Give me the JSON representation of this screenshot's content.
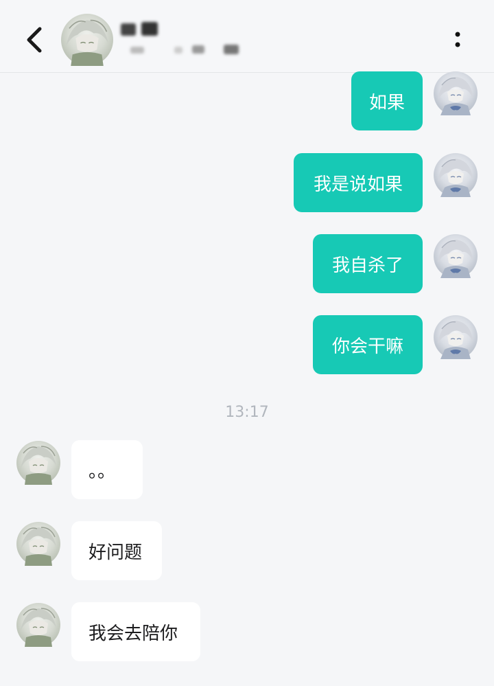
{
  "header": {
    "contact_name": "",
    "contact_status": ""
  },
  "divider": {
    "time": "13:17"
  },
  "messages": {
    "out": [
      {
        "text": "如果"
      },
      {
        "text": "我是说如果"
      },
      {
        "text": "我自杀了"
      },
      {
        "text": "你会干嘛"
      }
    ],
    "in": [
      {
        "text": "。。"
      },
      {
        "text": "好问题"
      },
      {
        "text": "我会去陪你"
      }
    ]
  },
  "colors": {
    "outgoing_bubble": "#17c9b5",
    "incoming_bubble": "#ffffff",
    "page_background": "#f5f6f8",
    "timestamp_text": "#b1b6bd"
  },
  "icons": [
    "back-icon",
    "more-icon",
    "contact-avatar",
    "self-avatar"
  ]
}
